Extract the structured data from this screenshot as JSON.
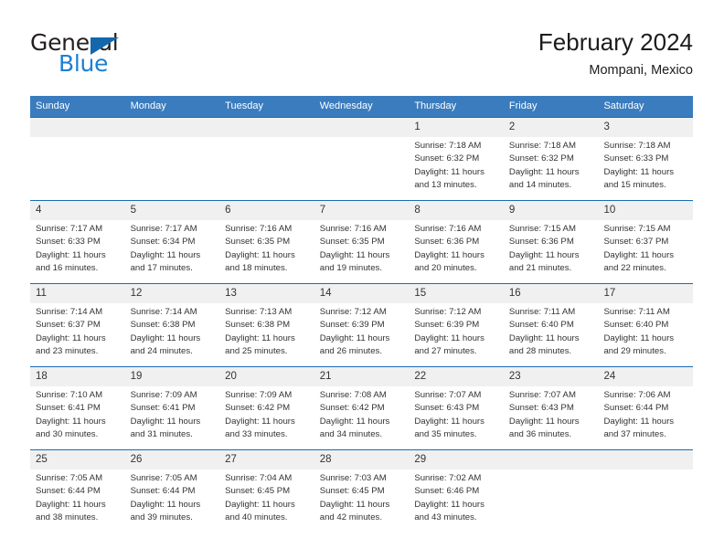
{
  "logo": {
    "word_one": "General",
    "word_two": "Blue",
    "triangle_color": "#1467ad",
    "blue_color": "#1a7fd4"
  },
  "header": {
    "title": "February 2024",
    "subtitle": "Mompani, Mexico"
  },
  "theme": {
    "header_row_bg": "#3a7cbe",
    "row_divider": "#1a6cb0",
    "day_number_bg": "#f0f0f0"
  },
  "weekdays": [
    "Sunday",
    "Monday",
    "Tuesday",
    "Wednesday",
    "Thursday",
    "Friday",
    "Saturday"
  ],
  "weeks": [
    [
      {
        "day": "",
        "sunrise": "",
        "sunset": "",
        "daylight_line1": "",
        "daylight_line2": ""
      },
      {
        "day": "",
        "sunrise": "",
        "sunset": "",
        "daylight_line1": "",
        "daylight_line2": ""
      },
      {
        "day": "",
        "sunrise": "",
        "sunset": "",
        "daylight_line1": "",
        "daylight_line2": ""
      },
      {
        "day": "",
        "sunrise": "",
        "sunset": "",
        "daylight_line1": "",
        "daylight_line2": ""
      },
      {
        "day": "1",
        "sunrise": "Sunrise: 7:18 AM",
        "sunset": "Sunset: 6:32 PM",
        "daylight_line1": "Daylight: 11 hours",
        "daylight_line2": "and 13 minutes."
      },
      {
        "day": "2",
        "sunrise": "Sunrise: 7:18 AM",
        "sunset": "Sunset: 6:32 PM",
        "daylight_line1": "Daylight: 11 hours",
        "daylight_line2": "and 14 minutes."
      },
      {
        "day": "3",
        "sunrise": "Sunrise: 7:18 AM",
        "sunset": "Sunset: 6:33 PM",
        "daylight_line1": "Daylight: 11 hours",
        "daylight_line2": "and 15 minutes."
      }
    ],
    [
      {
        "day": "4",
        "sunrise": "Sunrise: 7:17 AM",
        "sunset": "Sunset: 6:33 PM",
        "daylight_line1": "Daylight: 11 hours",
        "daylight_line2": "and 16 minutes."
      },
      {
        "day": "5",
        "sunrise": "Sunrise: 7:17 AM",
        "sunset": "Sunset: 6:34 PM",
        "daylight_line1": "Daylight: 11 hours",
        "daylight_line2": "and 17 minutes."
      },
      {
        "day": "6",
        "sunrise": "Sunrise: 7:16 AM",
        "sunset": "Sunset: 6:35 PM",
        "daylight_line1": "Daylight: 11 hours",
        "daylight_line2": "and 18 minutes."
      },
      {
        "day": "7",
        "sunrise": "Sunrise: 7:16 AM",
        "sunset": "Sunset: 6:35 PM",
        "daylight_line1": "Daylight: 11 hours",
        "daylight_line2": "and 19 minutes."
      },
      {
        "day": "8",
        "sunrise": "Sunrise: 7:16 AM",
        "sunset": "Sunset: 6:36 PM",
        "daylight_line1": "Daylight: 11 hours",
        "daylight_line2": "and 20 minutes."
      },
      {
        "day": "9",
        "sunrise": "Sunrise: 7:15 AM",
        "sunset": "Sunset: 6:36 PM",
        "daylight_line1": "Daylight: 11 hours",
        "daylight_line2": "and 21 minutes."
      },
      {
        "day": "10",
        "sunrise": "Sunrise: 7:15 AM",
        "sunset": "Sunset: 6:37 PM",
        "daylight_line1": "Daylight: 11 hours",
        "daylight_line2": "and 22 minutes."
      }
    ],
    [
      {
        "day": "11",
        "sunrise": "Sunrise: 7:14 AM",
        "sunset": "Sunset: 6:37 PM",
        "daylight_line1": "Daylight: 11 hours",
        "daylight_line2": "and 23 minutes."
      },
      {
        "day": "12",
        "sunrise": "Sunrise: 7:14 AM",
        "sunset": "Sunset: 6:38 PM",
        "daylight_line1": "Daylight: 11 hours",
        "daylight_line2": "and 24 minutes."
      },
      {
        "day": "13",
        "sunrise": "Sunrise: 7:13 AM",
        "sunset": "Sunset: 6:38 PM",
        "daylight_line1": "Daylight: 11 hours",
        "daylight_line2": "and 25 minutes."
      },
      {
        "day": "14",
        "sunrise": "Sunrise: 7:12 AM",
        "sunset": "Sunset: 6:39 PM",
        "daylight_line1": "Daylight: 11 hours",
        "daylight_line2": "and 26 minutes."
      },
      {
        "day": "15",
        "sunrise": "Sunrise: 7:12 AM",
        "sunset": "Sunset: 6:39 PM",
        "daylight_line1": "Daylight: 11 hours",
        "daylight_line2": "and 27 minutes."
      },
      {
        "day": "16",
        "sunrise": "Sunrise: 7:11 AM",
        "sunset": "Sunset: 6:40 PM",
        "daylight_line1": "Daylight: 11 hours",
        "daylight_line2": "and 28 minutes."
      },
      {
        "day": "17",
        "sunrise": "Sunrise: 7:11 AM",
        "sunset": "Sunset: 6:40 PM",
        "daylight_line1": "Daylight: 11 hours",
        "daylight_line2": "and 29 minutes."
      }
    ],
    [
      {
        "day": "18",
        "sunrise": "Sunrise: 7:10 AM",
        "sunset": "Sunset: 6:41 PM",
        "daylight_line1": "Daylight: 11 hours",
        "daylight_line2": "and 30 minutes."
      },
      {
        "day": "19",
        "sunrise": "Sunrise: 7:09 AM",
        "sunset": "Sunset: 6:41 PM",
        "daylight_line1": "Daylight: 11 hours",
        "daylight_line2": "and 31 minutes."
      },
      {
        "day": "20",
        "sunrise": "Sunrise: 7:09 AM",
        "sunset": "Sunset: 6:42 PM",
        "daylight_line1": "Daylight: 11 hours",
        "daylight_line2": "and 33 minutes."
      },
      {
        "day": "21",
        "sunrise": "Sunrise: 7:08 AM",
        "sunset": "Sunset: 6:42 PM",
        "daylight_line1": "Daylight: 11 hours",
        "daylight_line2": "and 34 minutes."
      },
      {
        "day": "22",
        "sunrise": "Sunrise: 7:07 AM",
        "sunset": "Sunset: 6:43 PM",
        "daylight_line1": "Daylight: 11 hours",
        "daylight_line2": "and 35 minutes."
      },
      {
        "day": "23",
        "sunrise": "Sunrise: 7:07 AM",
        "sunset": "Sunset: 6:43 PM",
        "daylight_line1": "Daylight: 11 hours",
        "daylight_line2": "and 36 minutes."
      },
      {
        "day": "24",
        "sunrise": "Sunrise: 7:06 AM",
        "sunset": "Sunset: 6:44 PM",
        "daylight_line1": "Daylight: 11 hours",
        "daylight_line2": "and 37 minutes."
      }
    ],
    [
      {
        "day": "25",
        "sunrise": "Sunrise: 7:05 AM",
        "sunset": "Sunset: 6:44 PM",
        "daylight_line1": "Daylight: 11 hours",
        "daylight_line2": "and 38 minutes."
      },
      {
        "day": "26",
        "sunrise": "Sunrise: 7:05 AM",
        "sunset": "Sunset: 6:44 PM",
        "daylight_line1": "Daylight: 11 hours",
        "daylight_line2": "and 39 minutes."
      },
      {
        "day": "27",
        "sunrise": "Sunrise: 7:04 AM",
        "sunset": "Sunset: 6:45 PM",
        "daylight_line1": "Daylight: 11 hours",
        "daylight_line2": "and 40 minutes."
      },
      {
        "day": "28",
        "sunrise": "Sunrise: 7:03 AM",
        "sunset": "Sunset: 6:45 PM",
        "daylight_line1": "Daylight: 11 hours",
        "daylight_line2": "and 42 minutes."
      },
      {
        "day": "29",
        "sunrise": "Sunrise: 7:02 AM",
        "sunset": "Sunset: 6:46 PM",
        "daylight_line1": "Daylight: 11 hours",
        "daylight_line2": "and 43 minutes."
      },
      {
        "day": "",
        "sunrise": "",
        "sunset": "",
        "daylight_line1": "",
        "daylight_line2": ""
      },
      {
        "day": "",
        "sunrise": "",
        "sunset": "",
        "daylight_line1": "",
        "daylight_line2": ""
      }
    ]
  ]
}
